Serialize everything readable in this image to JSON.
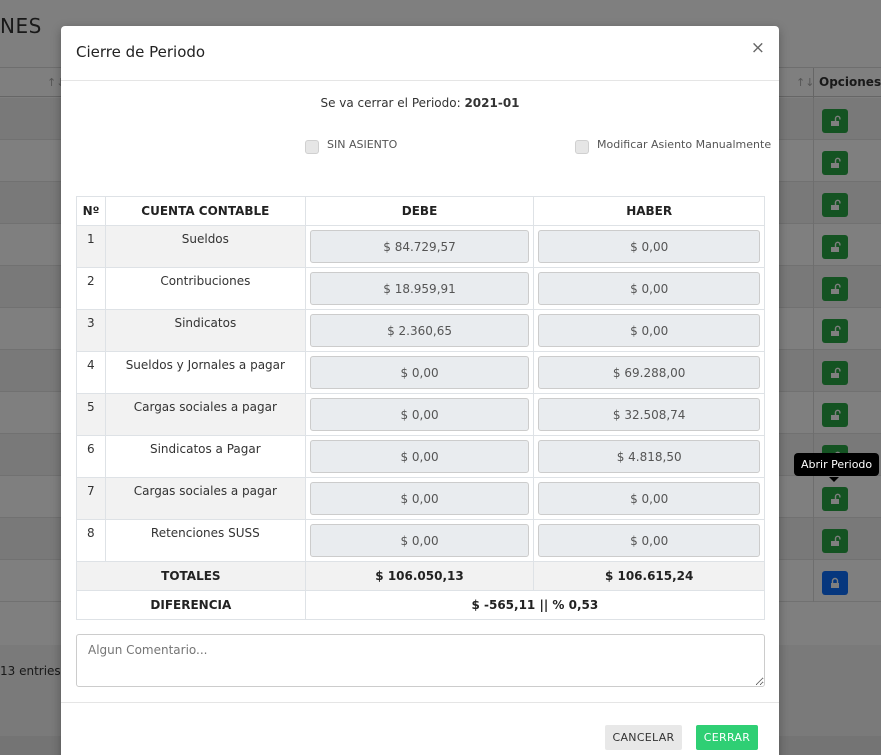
{
  "background": {
    "title": "NES",
    "sort_icon": "↑↓",
    "opciones_header": "Opciones",
    "entries_text": "13 entries",
    "rows": [
      {
        "icon": "unlock-icon",
        "state": "open"
      },
      {
        "icon": "unlock-icon",
        "state": "open"
      },
      {
        "icon": "unlock-icon",
        "state": "open"
      },
      {
        "icon": "unlock-icon",
        "state": "open"
      },
      {
        "icon": "unlock-icon",
        "state": "open"
      },
      {
        "icon": "unlock-icon",
        "state": "open"
      },
      {
        "icon": "unlock-icon",
        "state": "open"
      },
      {
        "icon": "unlock-icon",
        "state": "open"
      },
      {
        "icon": "unlock-icon",
        "state": "open"
      },
      {
        "icon": "unlock-icon",
        "state": "open"
      },
      {
        "icon": "unlock-icon",
        "state": "open"
      },
      {
        "icon": "lock-icon",
        "state": "closed"
      }
    ],
    "colors": {
      "open_button": "#28a745",
      "closed_button": "#0d6efd"
    }
  },
  "tooltip": {
    "text": "Abrir Periodo"
  },
  "modal": {
    "title": "Cierre de Periodo",
    "close_symbol": "×",
    "periodo_prefix": "Se va cerrar el Periodo:",
    "periodo_value": "2021-01",
    "checkbox_sin_asiento": "SIN ASIENTO",
    "checkbox_modificar": "Modificar Asiento Manualmente",
    "table": {
      "headers": {
        "num": "Nº",
        "cuenta": "CUENTA CONTABLE",
        "debe": "DEBE",
        "haber": "HABER"
      },
      "rows": [
        {
          "num": "1",
          "cuenta": "Sueldos",
          "debe": "$ 84.729,57",
          "haber": "$ 0,00"
        },
        {
          "num": "2",
          "cuenta": "Contribuciones",
          "debe": "$ 18.959,91",
          "haber": "$ 0,00"
        },
        {
          "num": "3",
          "cuenta": "Sindicatos",
          "debe": "$ 2.360,65",
          "haber": "$ 0,00"
        },
        {
          "num": "4",
          "cuenta": "Sueldos y Jornales a pagar",
          "debe": "$ 0,00",
          "haber": "$ 69.288,00"
        },
        {
          "num": "5",
          "cuenta": "Cargas sociales a pagar",
          "debe": "$ 0,00",
          "haber": "$ 32.508,74"
        },
        {
          "num": "6",
          "cuenta": "Sindicatos a Pagar",
          "debe": "$ 0,00",
          "haber": "$ 4.818,50"
        },
        {
          "num": "7",
          "cuenta": "Cargas sociales a pagar",
          "debe": "$ 0,00",
          "haber": "$ 0,00"
        },
        {
          "num": "8",
          "cuenta": "Retenciones SUSS",
          "debe": "$ 0,00",
          "haber": "$ 0,00"
        }
      ],
      "totales_label": "TOTALES",
      "totales_debe": "$ 106.050,13",
      "totales_haber": "$ 106.615,24",
      "diferencia_label": "DIFERENCIA",
      "diferencia_value": "$ -565,11 || % 0,53"
    },
    "comment_placeholder": "Algun Comentario...",
    "cancel_label": "CANCELAR",
    "cerrar_label": "CERRAR",
    "colors": {
      "cerrar_button": "#2fcf74"
    }
  }
}
